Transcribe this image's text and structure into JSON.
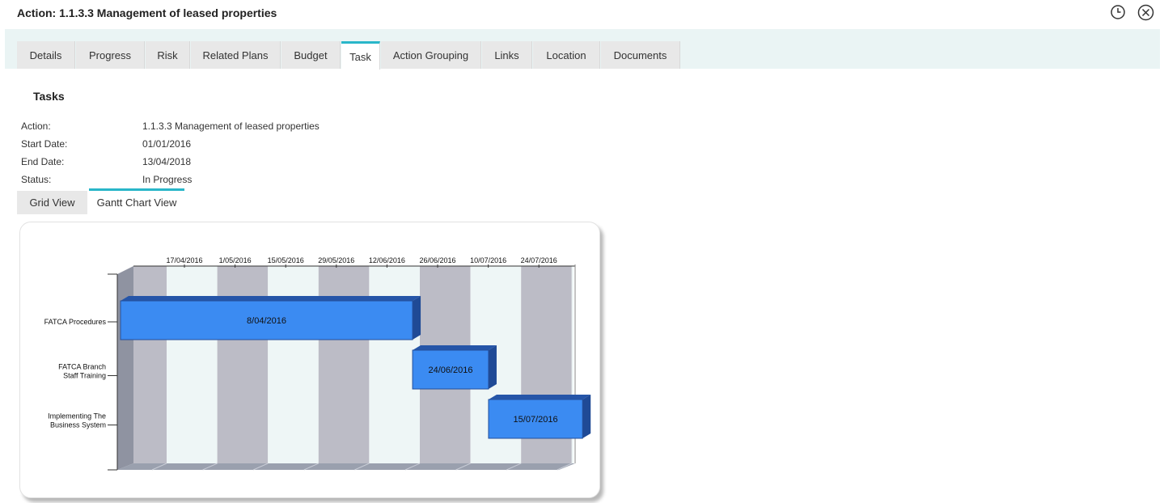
{
  "header": {
    "title": "Action: 1.1.3.3 Management of leased properties",
    "icons": [
      "history-icon",
      "close-icon"
    ]
  },
  "tabs": [
    {
      "label": "Details",
      "active": false
    },
    {
      "label": "Progress",
      "active": false
    },
    {
      "label": "Risk",
      "active": false
    },
    {
      "label": "Related Plans",
      "active": false
    },
    {
      "label": "Budget",
      "active": false
    },
    {
      "label": "Task",
      "active": true
    },
    {
      "label": "Action Grouping",
      "active": false
    },
    {
      "label": "Links",
      "active": false
    },
    {
      "label": "Location",
      "active": false
    },
    {
      "label": "Documents",
      "active": false
    }
  ],
  "section": {
    "title": "Tasks"
  },
  "info": {
    "action_label": "Action:",
    "action_value": "1.1.3.3 Management of leased properties",
    "start_label": "Start Date:",
    "start_value": "01/01/2016",
    "end_label": "End Date:",
    "end_value": "13/04/2018",
    "status_label": "Status:",
    "status_value": "In Progress"
  },
  "view_tabs": {
    "grid": "Grid View",
    "gantt": "Gantt Chart View",
    "active": "gantt"
  },
  "colors": {
    "accent": "#29b6c9",
    "bar": "#3b8bf2",
    "bar_dark": "#2555a8",
    "stripe_dark": "#bcbcc6",
    "stripe_light": "#eef6f6"
  },
  "chart_data": {
    "type": "gantt",
    "x_tick_labels": [
      "17/04/2016",
      "1/05/2016",
      "15/05/2016",
      "29/05/2016",
      "12/06/2016",
      "26/06/2016",
      "10/07/2016",
      "24/07/2016"
    ],
    "tasks": [
      {
        "name_lines": [
          "FATCA Procedures"
        ],
        "start": "2016-04-08",
        "end": "2016-06-24",
        "label": "8/04/2016"
      },
      {
        "name_lines": [
          "FATCA Branch",
          "Staff Training"
        ],
        "start": "2016-06-24",
        "end": "2016-07-15",
        "label": "24/06/2016"
      },
      {
        "name_lines": [
          "Implementing The",
          "Business System"
        ],
        "start": "2016-07-15",
        "end": "2016-08-10",
        "label": "15/07/2016"
      }
    ]
  }
}
